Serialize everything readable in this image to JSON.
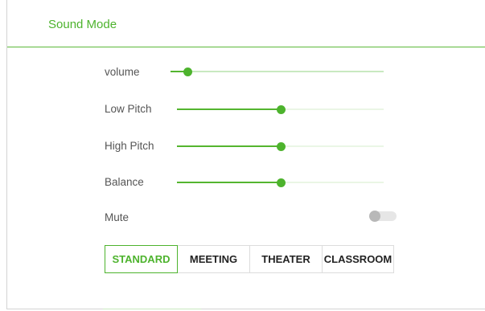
{
  "header": {
    "title": "Sound Mode"
  },
  "sliders": [
    {
      "id": "volume",
      "label": "volume",
      "value": 0.08
    },
    {
      "id": "low-pitch",
      "label": "Low Pitch",
      "value": 0.5
    },
    {
      "id": "high-pitch",
      "label": "High Pitch",
      "value": 0.5
    },
    {
      "id": "balance",
      "label": "Balance",
      "value": 0.5
    }
  ],
  "mute": {
    "label": "Mute",
    "on": false
  },
  "modes": {
    "selected": "STANDARD",
    "items": [
      "STANDARD",
      "MEETING",
      "THEATER",
      "CLASSROOM"
    ]
  },
  "colors": {
    "accent": "#4db32d",
    "track": "#c9e9c0",
    "text": "#555555"
  }
}
